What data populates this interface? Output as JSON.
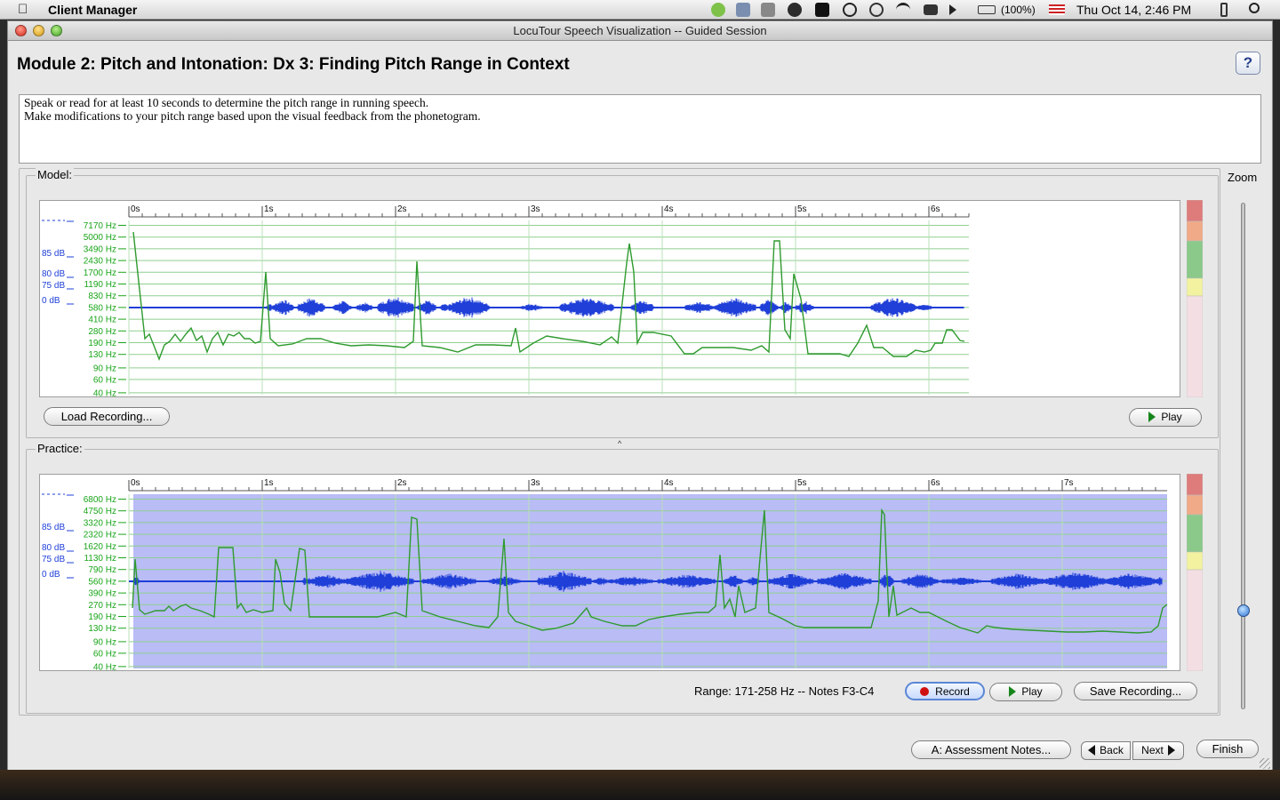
{
  "menubar": {
    "app_name": "Client Manager",
    "battery": "(100%)",
    "clock": "Thu Oct 14,  2:46 PM",
    "icons": [
      "apple-icon",
      "evernote-icon",
      "script-icon",
      "tools-icon",
      "globe-icon",
      "grid-icon",
      "accessibility-icon",
      "time-machine-icon",
      "wifi-icon",
      "display-icon",
      "volume-icon",
      "battery-icon",
      "flag-icon",
      "bluetooth-icon",
      "spotlight-icon"
    ]
  },
  "window": {
    "title": "LocuTour Speech Visualization -- Guided Session",
    "heading": "Module 2: Pitch and Intonation: Dx 3: Finding Pitch Range in Context",
    "help_label": "?",
    "instructions": [
      "Speak or read for at least 10 seconds to determine the pitch range in running speech.",
      "Make modifications to your pitch range based upon the visual feedback from the phonetogram."
    ]
  },
  "model": {
    "label": "Model:",
    "load_button": "Load Recording...",
    "play_button": "Play",
    "db_labels": [
      "85 dB",
      "80 dB",
      "75 dB",
      "0 dB"
    ],
    "freq_labels": [
      "7170 Hz",
      "5000 Hz",
      "3490 Hz",
      "2430 Hz",
      "1700 Hz",
      "1190 Hz",
      "830 Hz",
      "580 Hz",
      "410 Hz",
      "280 Hz",
      "190 Hz",
      "130 Hz",
      "90 Hz",
      "60 Hz",
      "40 Hz"
    ],
    "time_labels": [
      "0s",
      "1s",
      "2s",
      "3s",
      "4s",
      "5s",
      "6s"
    ]
  },
  "practice": {
    "label": "Practice:",
    "record_button": "Record",
    "play_button": "Play",
    "save_button": "Save Recording...",
    "range_text": "Range: 171-258 Hz -- Notes F3-C4",
    "db_labels": [
      "85 dB",
      "80 dB",
      "75 dB",
      "0 dB"
    ],
    "freq_labels": [
      "6800 Hz",
      "4750 Hz",
      "3320 Hz",
      "2320 Hz",
      "1620 Hz",
      "1130 Hz",
      "790 Hz",
      "560 Hz",
      "390 Hz",
      "270 Hz",
      "190 Hz",
      "130 Hz",
      "90 Hz",
      "60 Hz",
      "40 Hz"
    ],
    "time_labels": [
      "0s",
      "1s",
      "2s",
      "3s",
      "4s",
      "5s",
      "6s",
      "7s"
    ]
  },
  "zoom": {
    "label": "Zoom",
    "level": 0.18
  },
  "footer": {
    "notes_button": "A: Assessment Notes...",
    "back_button": "Back",
    "next_button": "Next",
    "finish_button": "Finish"
  },
  "colors": {
    "pitch": "#2f9a2f",
    "waveform": "#1f3fd8",
    "selection": "#b9bcf5",
    "label_green": "#1aa51a",
    "label_blue": "#1f3fd8"
  }
}
